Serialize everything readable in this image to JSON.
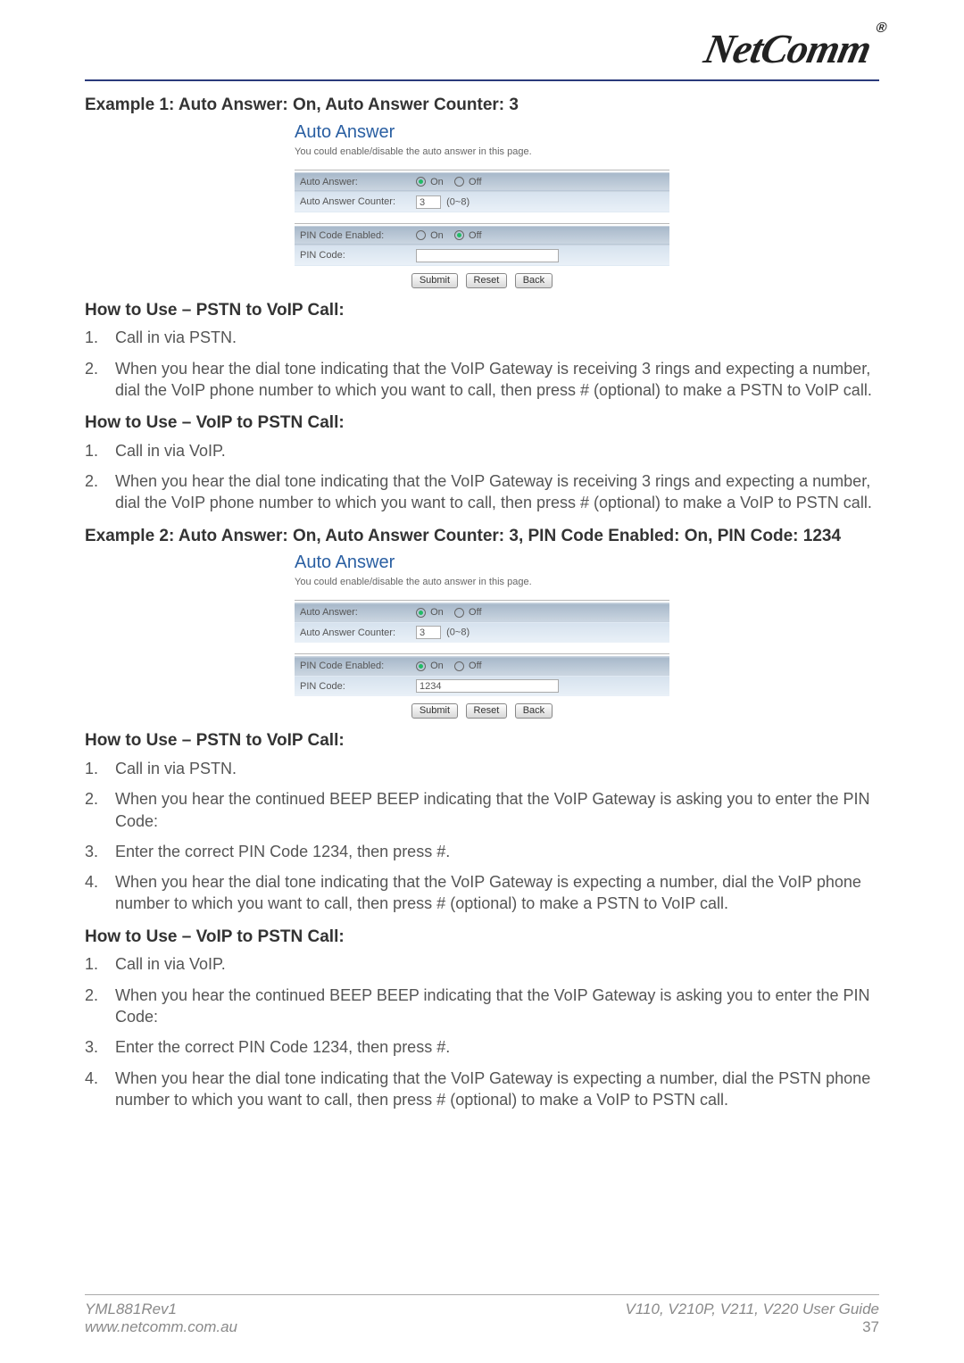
{
  "brand": {
    "name": "NetComm",
    "reg": "®"
  },
  "example1": {
    "heading": "Example 1: Auto Answer: On, Auto Answer Counter: 3",
    "ui": {
      "title": "Auto Answer",
      "subtitle": "You could enable/disable the auto answer in this page.",
      "rows": {
        "auto_answer_label": "Auto Answer:",
        "auto_answer_on": "On",
        "auto_answer_off": "Off",
        "auto_answer_on_checked": true,
        "auto_answer_off_checked": false,
        "counter_label": "Auto Answer Counter:",
        "counter_value": "3",
        "counter_hint": "(0~8)",
        "pin_enabled_label": "PIN Code Enabled:",
        "pin_on": "On",
        "pin_off": "Off",
        "pin_on_checked": false,
        "pin_off_checked": true,
        "pin_code_label": "PIN Code:",
        "pin_code_value": ""
      },
      "buttons": {
        "submit": "Submit",
        "reset": "Reset",
        "back": "Back"
      }
    },
    "howA": {
      "title": "How to Use – PSTN to VoIP Call:",
      "steps": [
        "Call in via PSTN.",
        "When you hear the dial tone indicating that the VoIP Gateway is receiving 3 rings and expecting a number, dial the VoIP phone number to which you want to call, then press # (optional) to make a PSTN to VoIP call."
      ]
    },
    "howB": {
      "title": "How to Use – VoIP to PSTN Call:",
      "steps": [
        "Call in via VoIP.",
        "When you hear the dial tone indicating that the VoIP Gateway is receiving 3 rings and expecting a number, dial the VoIP phone number to which you want to call, then press # (optional) to make a VoIP to PSTN call."
      ]
    }
  },
  "example2": {
    "heading": "Example 2: Auto Answer: On, Auto Answer Counter: 3, PIN Code Enabled: On, PIN Code: 1234",
    "ui": {
      "title": "Auto Answer",
      "subtitle": "You could enable/disable the auto answer in this page.",
      "rows": {
        "auto_answer_label": "Auto Answer:",
        "auto_answer_on": "On",
        "auto_answer_off": "Off",
        "auto_answer_on_checked": true,
        "auto_answer_off_checked": false,
        "counter_label": "Auto Answer Counter:",
        "counter_value": "3",
        "counter_hint": "(0~8)",
        "pin_enabled_label": "PIN Code Enabled:",
        "pin_on": "On",
        "pin_off": "Off",
        "pin_on_checked": true,
        "pin_off_checked": false,
        "pin_code_label": "PIN Code:",
        "pin_code_value": "1234"
      },
      "buttons": {
        "submit": "Submit",
        "reset": "Reset",
        "back": "Back"
      }
    },
    "howA": {
      "title": "How to Use – PSTN to VoIP Call:",
      "steps": [
        "Call in via PSTN.",
        "When you hear the continued BEEP BEEP indicating that the VoIP Gateway is asking you to enter the PIN Code:",
        "Enter the correct PIN Code 1234, then press #.",
        "When you hear the dial tone indicating that the VoIP Gateway is expecting a number, dial the VoIP phone number to which you want to call, then press # (optional) to make a PSTN to VoIP call."
      ]
    },
    "howB": {
      "title": "How to Use – VoIP to PSTN Call:",
      "steps": [
        "Call in via VoIP.",
        "When you hear the continued BEEP BEEP indicating that the VoIP Gateway is asking you to enter the PIN Code:",
        "Enter the correct PIN Code 1234, then press #.",
        "When you hear the dial tone indicating that the VoIP Gateway is expecting a number, dial the PSTN phone number to which you want to call, then press # (optional) to make a VoIP to PSTN call."
      ]
    }
  },
  "footer": {
    "left_top": "YML881Rev1",
    "left_bottom": "www.netcomm.com.au",
    "right_top": "V110, V210P, V211, V220 User Guide",
    "right_bottom": "37"
  }
}
